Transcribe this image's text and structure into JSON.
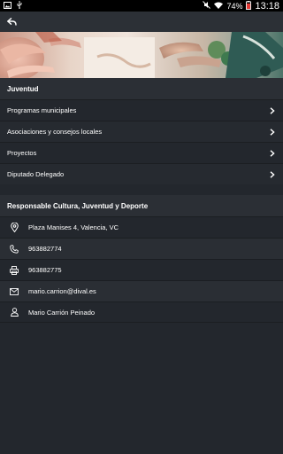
{
  "status_bar": {
    "battery_percent": "74%",
    "time": "13:18"
  },
  "section_title": "Juventud",
  "menu_items": [
    {
      "label": "Programas municipales"
    },
    {
      "label": "Asociaciones y consejos locales"
    },
    {
      "label": "Proyectos"
    },
    {
      "label": "Diputado Delegado"
    }
  ],
  "responsible_title": "Responsable Cultura, Juventud y Deporte",
  "contacts": {
    "address": "Plaza Manises 4, Valencia, VC",
    "phone": "963882774",
    "fax": "963882775",
    "email": "mario.carrion@dival.es",
    "person": "Mario Carrión Peinado"
  },
  "icons": {
    "back": "back-arrow-icon",
    "chevron": "chevron-right-icon",
    "address": "location-pin-icon",
    "phone": "phone-icon",
    "fax": "printer-icon",
    "email": "envelope-icon",
    "person": "person-icon"
  },
  "colors": {
    "background": "#23272d",
    "header": "#2b2f35",
    "text": "#ffffff"
  }
}
